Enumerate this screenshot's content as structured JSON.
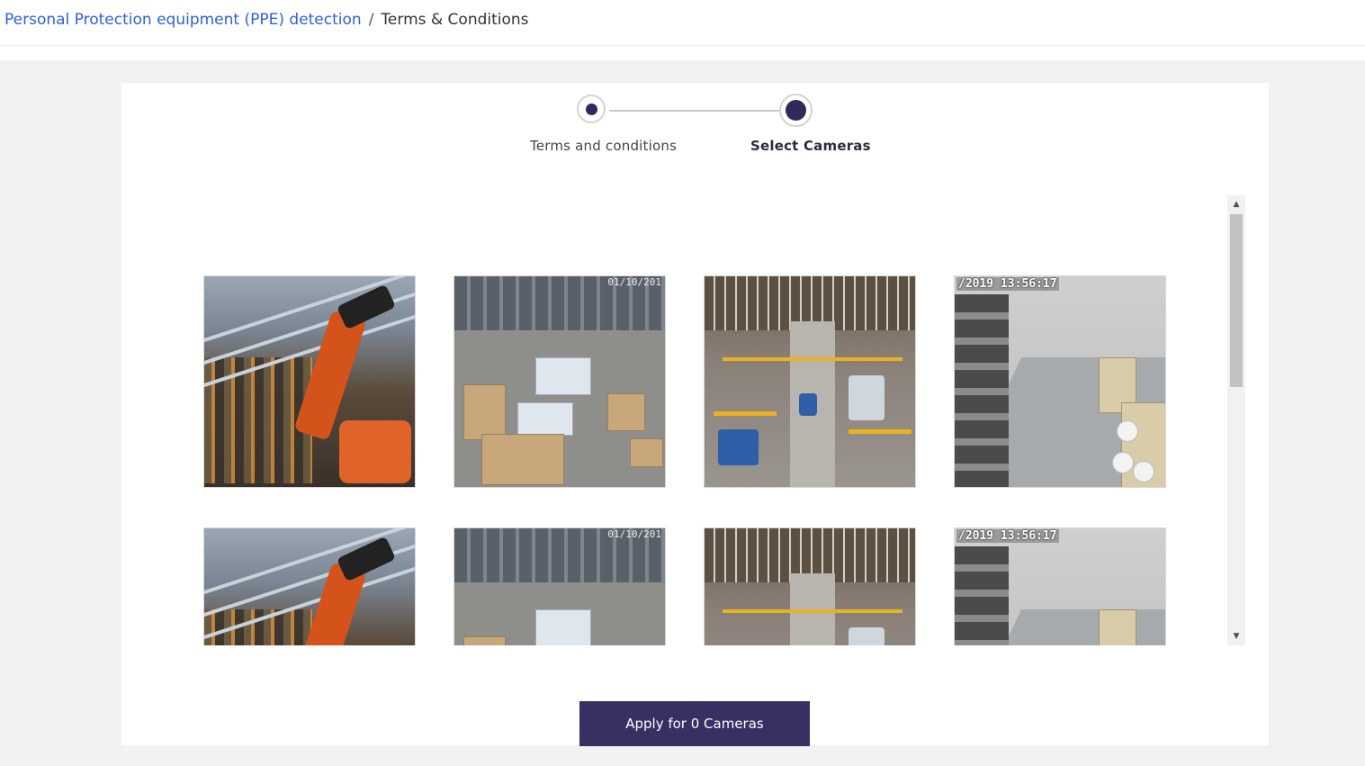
{
  "breadcrumb": {
    "parent": "Personal Protection equipment (PPE) detection",
    "separator": "/",
    "current": "Terms & Conditions"
  },
  "stepper": {
    "steps": [
      {
        "label": "Terms and conditions",
        "state": "completed"
      },
      {
        "label": "Select Cameras",
        "state": "active"
      }
    ]
  },
  "cameras": [
    {
      "scene": "robot-arm-assembly",
      "timestamp": ""
    },
    {
      "scene": "warehouse-packing",
      "timestamp": "01/10/201"
    },
    {
      "scene": "factory-aisle",
      "timestamp": ""
    },
    {
      "scene": "corridor",
      "timestamp": "/2019 13:56:17"
    },
    {
      "scene": "robot-arm-assembly",
      "timestamp": ""
    },
    {
      "scene": "warehouse-packing",
      "timestamp": "01/10/201"
    },
    {
      "scene": "factory-aisle",
      "timestamp": ""
    },
    {
      "scene": "corridor",
      "timestamp": "/2019 13:56:17"
    }
  ],
  "apply_button": {
    "label": "Apply for 0 Cameras"
  },
  "colors": {
    "link": "#2d5fe0",
    "primary": "#382f63",
    "step_active": "#2f2a5b",
    "background": "#f2f2f2"
  },
  "scrollbar": {
    "up_icon": "triangle-up",
    "down_icon": "triangle-down"
  }
}
